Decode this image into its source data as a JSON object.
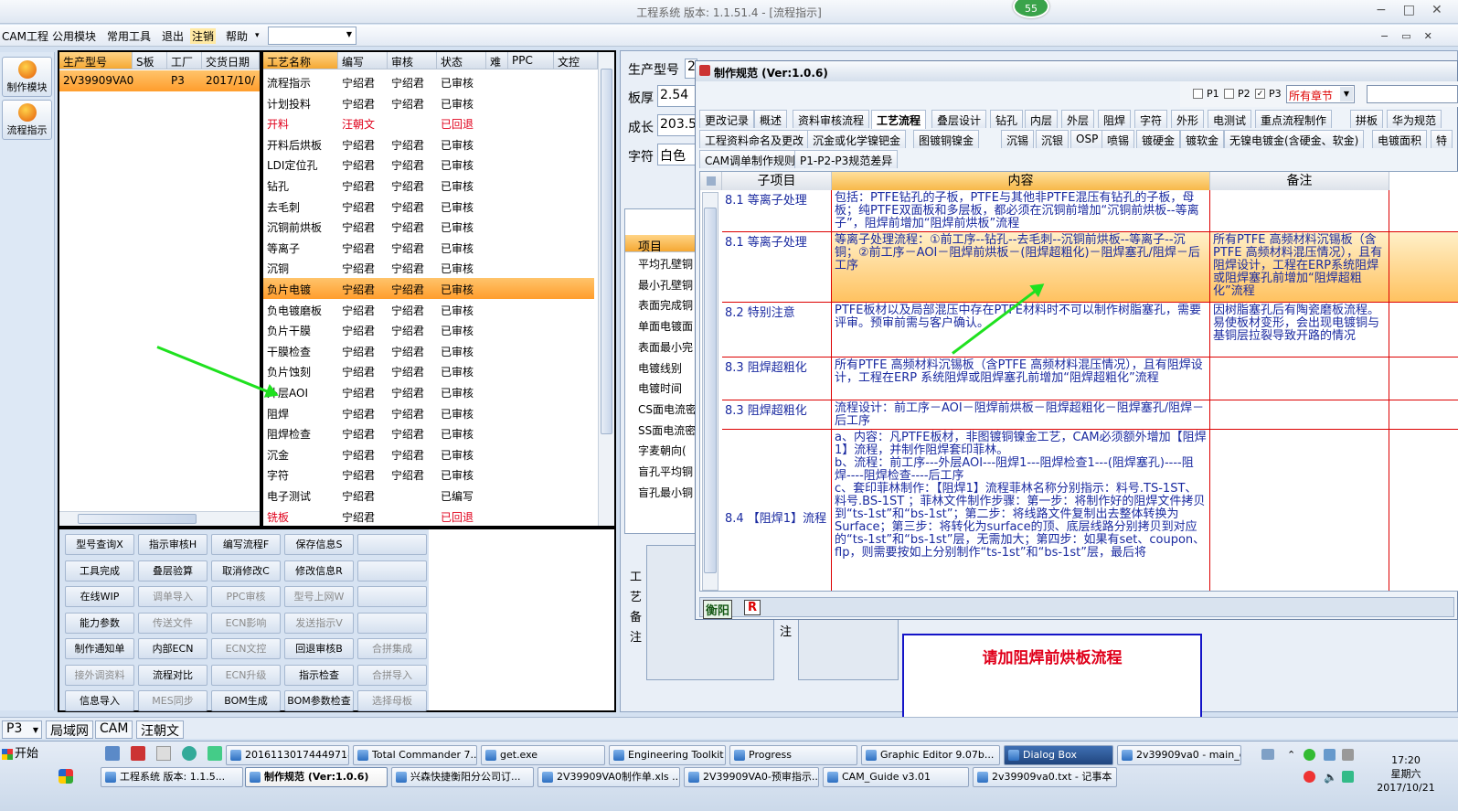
{
  "window": {
    "title": "工程系统  版本: 1.1.51.4 - [流程指示]",
    "badge": "55"
  },
  "menu": [
    "CAM工程",
    "公用模块",
    "常用工具",
    "退出",
    "注销",
    "帮助"
  ],
  "left_nav": [
    "制作模块",
    "流程指示"
  ],
  "product_table": {
    "headers": [
      "生产型号",
      "S板",
      "工厂",
      "交货日期"
    ],
    "row": [
      "2V39909VA0",
      "",
      "P3",
      "2017/10/"
    ]
  },
  "process_table": {
    "headers": [
      "工艺名称",
      "编写",
      "审核",
      "状态",
      "难",
      "PPC",
      "文控"
    ],
    "rows": [
      [
        "流程指示",
        "宁绍君",
        "宁绍君",
        "已审核"
      ],
      [
        "计划投料",
        "宁绍君",
        "宁绍君",
        "已审核"
      ],
      [
        "开料",
        "汪朝文",
        "",
        "已回退"
      ],
      [
        "开料后烘板",
        "宁绍君",
        "宁绍君",
        "已审核"
      ],
      [
        "LDI定位孔",
        "宁绍君",
        "宁绍君",
        "已审核"
      ],
      [
        "钻孔",
        "宁绍君",
        "宁绍君",
        "已审核"
      ],
      [
        "去毛刺",
        "宁绍君",
        "宁绍君",
        "已审核"
      ],
      [
        "沉铜前烘板",
        "宁绍君",
        "宁绍君",
        "已审核"
      ],
      [
        "等离子",
        "宁绍君",
        "宁绍君",
        "已审核"
      ],
      [
        "沉铜",
        "宁绍君",
        "宁绍君",
        "已审核"
      ],
      [
        "负片电镀",
        "宁绍君",
        "宁绍君",
        "已审核"
      ],
      [
        "负电镀磨板",
        "宁绍君",
        "宁绍君",
        "已审核"
      ],
      [
        "负片干膜",
        "宁绍君",
        "宁绍君",
        "已审核"
      ],
      [
        "干膜检查",
        "宁绍君",
        "宁绍君",
        "已审核"
      ],
      [
        "负片蚀刻",
        "宁绍君",
        "宁绍君",
        "已审核"
      ],
      [
        "外层AOI",
        "宁绍君",
        "宁绍君",
        "已审核"
      ],
      [
        "阻焊",
        "宁绍君",
        "宁绍君",
        "已审核"
      ],
      [
        "阻焊检查",
        "宁绍君",
        "宁绍君",
        "已审核"
      ],
      [
        "沉金",
        "宁绍君",
        "宁绍君",
        "已审核"
      ],
      [
        "字符",
        "宁绍君",
        "宁绍君",
        "已审核"
      ],
      [
        "电子测试",
        "宁绍君",
        "",
        "已编写"
      ],
      [
        "铣板",
        "宁绍君",
        "",
        "已回退"
      ]
    ]
  },
  "buttons": [
    [
      "型号查询X",
      "指示审核H",
      "编写流程F",
      "保存信息S",
      ""
    ],
    [
      "工具完成",
      "叠层验算",
      "取消修改C",
      "修改信息R",
      ""
    ],
    [
      "在线WIP",
      "调单导入",
      "PPC审核",
      "型号上网W",
      ""
    ],
    [
      "能力参数",
      "传送文件",
      "ECN影响",
      "发送指示V",
      ""
    ],
    [
      "制作通知单",
      "内部ECN",
      "ECN文控",
      "回退审核B",
      "合拼集成"
    ],
    [
      "接外调资料",
      "流程对比",
      "ECN升级",
      "指示检查",
      "合拼导入"
    ],
    [
      "信息导入",
      "MES同步",
      "BOM生成",
      "BOM参数检查",
      "选择母板"
    ]
  ],
  "disabled_buttons": [
    "调单导入",
    "PPC审核",
    "型号上网W",
    "传送文件",
    "ECN影响",
    "发送指示V",
    "ECN文控",
    "合拼集成",
    "接外调资料",
    "ECN升级",
    "合拼导入",
    "MES同步",
    "选择母板"
  ],
  "right_fields": {
    "labels": [
      "生产型号",
      "板厚",
      "成长",
      "字符"
    ],
    "values": [
      "2",
      "2.54",
      "203.5",
      "白色"
    ]
  },
  "right_items": {
    "header": "项目",
    "items": [
      "平均孔壁铜",
      "最小孔壁铜",
      "表面完成铜",
      "单面电镀面",
      "表面最小完",
      "电镀线别",
      "电镀时间",
      "CS面电流密",
      "SS面电流密",
      "字麦朝向(",
      "盲孔平均铜",
      "盲孔最小铜"
    ]
  },
  "vertical_label": [
    "工",
    "艺",
    "备",
    "注"
  ],
  "note_label": "注",
  "dialog": {
    "title": "制作规范 (Ver:1.0.6)",
    "checks": [
      "P1",
      "P2",
      "P3"
    ],
    "chapter": "所有章节",
    "tabs1": [
      "更改记录",
      "概述",
      "资料审核流程",
      "工艺流程",
      "叠层设计",
      "钻孔",
      "内层",
      "外层",
      "阻焊",
      "字符",
      "外形",
      "电测试",
      "重点流程制作",
      "拼板",
      "华为规范"
    ],
    "tabs2": [
      "工程资料命名及更改",
      "沉金或化学镍钯金",
      "图镀铜镍金",
      "沉锡",
      "沉银",
      "OSP",
      "喷锡",
      "镀硬金",
      "镀软金",
      "无镍电镀金(含硬金、软金)",
      "电镀面积",
      "特"
    ],
    "tabs3": [
      "CAM调单制作规则",
      "P1-P2-P3规范差异"
    ],
    "grid_headers": [
      "子项目",
      "内容",
      "备注"
    ],
    "rows": [
      {
        "sub": "8.1 等离子处理",
        "content": "包括：PTFE钻孔的子板，PTFE与其他非PTFE混压有钻孔的子板，母板；纯PTFE双面板和多层板，都必须在沉铜前增加“沉铜前烘板--等离子”，阻焊前增加“阻焊前烘板”流程",
        "note": ""
      },
      {
        "sub": "8.1 等离子处理",
        "content": "等离子处理流程：①前工序--钻孔--去毛刺--沉铜前烘板--等离子--沉铜；②前工序－AOI－阻焊前烘板－(阻焊超粗化)－阻焊塞孔/阻焊－后工序",
        "note": "所有PTFE 高频材料沉锡板（含PTFE 高频材料混压情况），且有阻焊设计，工程在ERP系统阻焊或阻焊塞孔前增加“阻焊超粗化”流程"
      },
      {
        "sub": "8.2 特别注意",
        "content": "PTFE板材以及局部混压中存在PTFE材料时不可以制作树脂塞孔，需要评审。预审前需与客户确认。",
        "note": "因树脂塞孔后有陶瓷磨板流程。易使板材变形，会出现电镀铜与基铜层拉裂导致开路的情况"
      },
      {
        "sub": "8.3 阻焊超粗化",
        "content": "所有PTFE 高频材料沉锡板（含PTFE 高频材料混压情况），且有阻焊设计，工程在ERP 系统阻焊或阻焊塞孔前增加“阻焊超粗化”流程",
        "note": ""
      },
      {
        "sub": "8.3 阻焊超粗化",
        "content": "流程设计：前工序－AOI－阻焊前烘板－阻焊超粗化－阻焊塞孔/阻焊－后工序",
        "note": ""
      },
      {
        "sub": "8.4 【阻焊1】流程",
        "content": "a、内容：凡PTFE板材，非图镀铜镍金工艺，CAM必须额外增加【阻焊1】流程，并制作阻焊套印菲林。\nb、流程：前工序---外层AOI---阻焊1---阻焊检查1---(阻焊塞孔)----阻焊----阻焊检查----后工序\nc、套印菲林制作：【阻焊1】流程菲林名称分别指示：料号.TS-1ST、料号.BS-1ST ；菲林文件制作步骤：第一步：将制作好的阻焊文件拷贝到“ts-1st”和“bs-1st”；第二步：将线路文件复制出去整体转换为Surface；第三步：将转化为surface的顶、底层线路分别拷贝到对应的“ts-1st”和“bs-1st”层，无需加大；第四步：如果有set、coupon、flp，则需要按如上分别制作“ts-1st”和“bs-1st”层，最后将",
        "note": ""
      }
    ],
    "footer": [
      "衡阳",
      "R"
    ]
  },
  "callout": "请加阻焊前烘板流程",
  "status": [
    "P3",
    "局域网",
    "CAM",
    "汪朝文"
  ],
  "taskbar": {
    "start": "开始",
    "row1": [
      "20161130174449718...",
      "Total Commander 7....",
      "get.exe",
      "Engineering Toolkit 9...",
      "Progress",
      "Graphic Editor 9.07b...",
      "Dialog Box",
      "2v39909va0 - main_qa"
    ],
    "row2": [
      "工程系统  版本: 1.1.5...",
      "制作规范 (Ver:1.0.6)",
      "兴森快捷衡阳分公司订...",
      "2V39909VA0制作单.xls ...",
      "2V39909VA0-预审指示....",
      "CAM_Guide v3.01",
      "2v39909va0.txt - 记事本"
    ],
    "clock": "17:20",
    "weekday": "星期六",
    "date": "2017/10/21"
  },
  "colors": {
    "accent": "#f5a833",
    "red": "#e0001b",
    "arrow": "#1fe11f",
    "callout_border": "#1414c8"
  }
}
